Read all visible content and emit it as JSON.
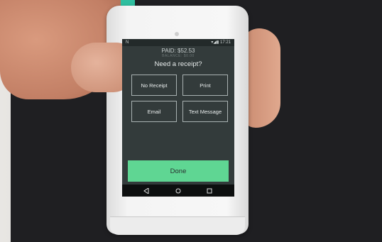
{
  "status_bar": {
    "left": "N",
    "right": "▾◢▮ 17:21"
  },
  "payment": {
    "paid": "PAID: $52.53",
    "balance": "BALANCE: $0.00"
  },
  "prompt": "Need a receipt?",
  "options": [
    "No Receipt",
    "Print",
    "Email",
    "Text Message"
  ],
  "done_label": "Done",
  "colors": {
    "screen_bg": "#333b3b",
    "done_button": "#5fd693",
    "option_border": "#a9b2b2"
  },
  "nav_icons": [
    "back-icon",
    "home-icon",
    "recents-icon"
  ]
}
